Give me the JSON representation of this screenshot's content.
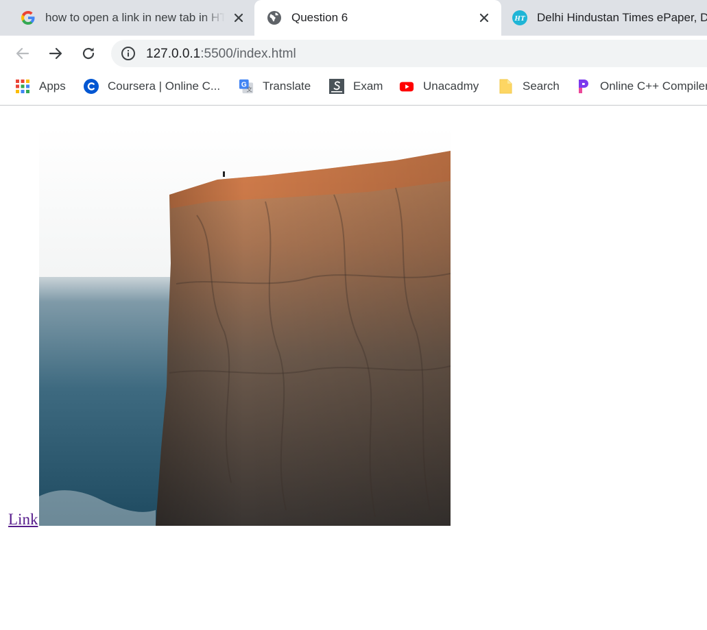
{
  "tabs": [
    {
      "title": "how to open a link in new tab in HTML",
      "favicon": "google-icon"
    },
    {
      "title": "Question 6",
      "favicon": "globe-icon",
      "active": true
    },
    {
      "title": "Delhi Hindustan Times ePaper, Delhi",
      "favicon": "ht-icon"
    }
  ],
  "toolbar": {
    "url_host": "127.0.0.1",
    "url_rest": ":5500/index.html"
  },
  "bookmarks": [
    {
      "label": "Apps",
      "icon": "apps-grid-icon"
    },
    {
      "label": "Coursera | Online C...",
      "icon": "coursera-icon"
    },
    {
      "label": "Translate",
      "icon": "translate-icon"
    },
    {
      "label": "Exam",
      "icon": "exam-icon"
    },
    {
      "label": "Unacadmy",
      "icon": "youtube-icon"
    },
    {
      "label": "Search",
      "icon": "folder-icon"
    },
    {
      "label": "Online C++ Compiler",
      "icon": "programiz-icon"
    }
  ],
  "page": {
    "link_text": "Link"
  }
}
